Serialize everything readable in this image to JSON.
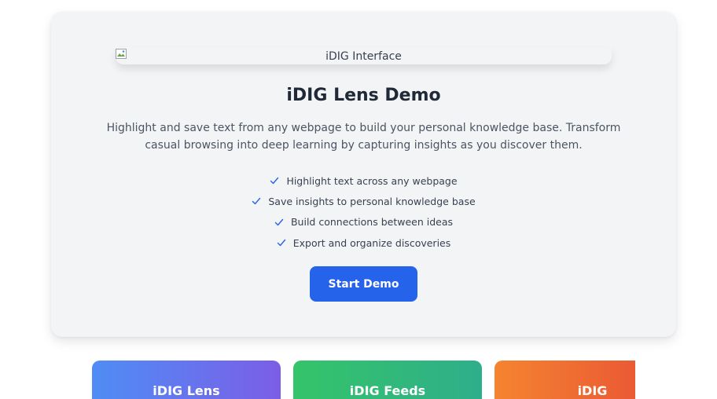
{
  "demo": {
    "image_alt": "iDIG Interface",
    "title": "iDIG Lens Demo",
    "description": "Highlight and save text from any webpage to build your personal knowledge base. Transform casual browsing into deep learning by capturing insights as you discover them.",
    "features": [
      "Highlight text across any webpage",
      "Save insights to personal knowledge base",
      "Build connections between ideas",
      "Export and organize discoveries"
    ],
    "button_label": "Start Demo"
  },
  "products": [
    {
      "label": "iDIG Lens"
    },
    {
      "label": "iDIG Feeds"
    },
    {
      "label": "iDIG Matching"
    }
  ],
  "colors": {
    "accent": "#2563eb",
    "card_bg": "#f3f4f6",
    "check": "#2563eb"
  }
}
